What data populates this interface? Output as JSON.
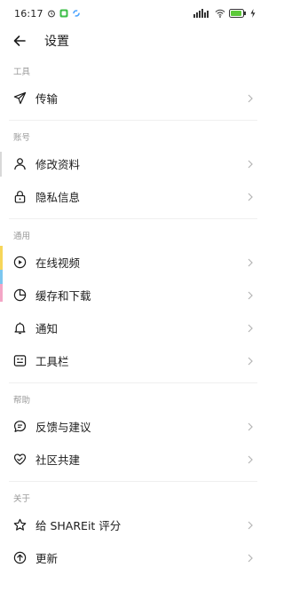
{
  "status_bar": {
    "time": "16:17",
    "signal": "ₐₗₗ",
    "battery_color": "#5cc93a"
  },
  "header": {
    "title": "设置"
  },
  "sections": [
    {
      "label": "工具",
      "items": [
        {
          "label": "传输",
          "icon": "send-icon"
        }
      ]
    },
    {
      "label": "账号",
      "items": [
        {
          "label": "修改资料",
          "icon": "user-icon"
        },
        {
          "label": "隐私信息",
          "icon": "lock-icon"
        }
      ]
    },
    {
      "label": "通用",
      "items": [
        {
          "label": "在线视频",
          "icon": "play-circle-icon"
        },
        {
          "label": "缓存和下载",
          "icon": "pie-clock-icon"
        },
        {
          "label": "通知",
          "icon": "bell-icon"
        },
        {
          "label": "工具栏",
          "icon": "toolbar-icon"
        }
      ]
    },
    {
      "label": "帮助",
      "items": [
        {
          "label": "反馈与建议",
          "icon": "feedback-icon"
        },
        {
          "label": "社区共建",
          "icon": "heart-hands-icon"
        }
      ]
    },
    {
      "label": "关于",
      "items": [
        {
          "label": "给 SHAREit 评分",
          "icon": "star-icon"
        },
        {
          "label": "更新",
          "icon": "upload-icon"
        }
      ]
    }
  ],
  "accent_marks": [
    "#f6d65a",
    "#7cc6ef",
    "#f3a6c6"
  ]
}
